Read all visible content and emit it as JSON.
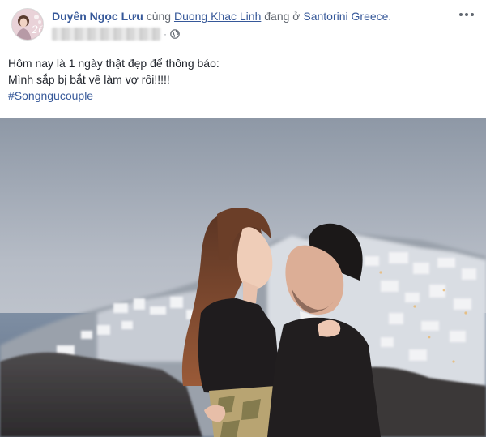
{
  "post": {
    "author": "Duyên Ngọc Lưu",
    "with_word": "cùng",
    "tagged_person": "Duong Khac Linh",
    "at_word": "đang ở",
    "location": "Santorini Greece.",
    "privacy_icon": "globe-icon",
    "more_icon": "more-options-icon",
    "lines": [
      "Hôm nay là 1 ngày thật đẹp để thông báo:",
      "Mình sắp bị bắt về làm vợ rồi!!!!!"
    ],
    "hashtag": "#Songngucouple",
    "photo_icon": "couple-photo"
  },
  "colors": {
    "link": "#365899",
    "text": "#1d2129",
    "muted": "#616770"
  }
}
